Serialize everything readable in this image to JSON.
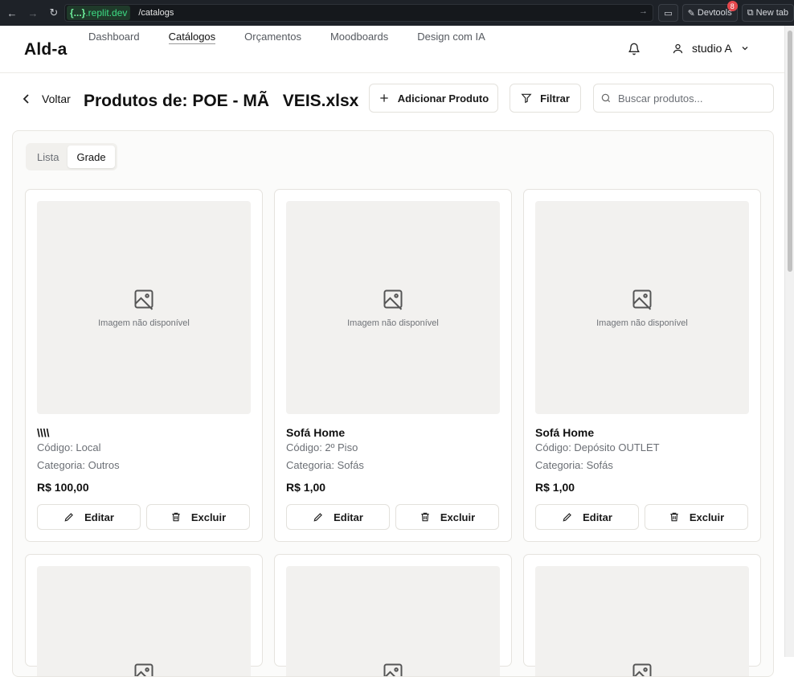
{
  "browser": {
    "url_host_prefix": "{...}",
    "url_host_suffix": ".replit.dev",
    "url_path": "/catalogs",
    "devtools_label": "Devtools",
    "devtools_badge": "8",
    "newtab_label": "New tab"
  },
  "header": {
    "logo": "Ald-a",
    "nav": [
      "Dashboard",
      "Catálogos",
      "Orçamentos",
      "Moodboards",
      "Design com IA"
    ],
    "active_nav": "Catálogos",
    "user_name": "studio A"
  },
  "toolbar": {
    "back_label": "Voltar",
    "title": "Produtos de: POE - MÃVEIS.xlsx",
    "add_label": "Adicionar Produto",
    "filter_label": "Filtrar",
    "search_placeholder": "Buscar produtos..."
  },
  "view_toggle": {
    "list_label": "Lista",
    "grid_label": "Grade",
    "selected": "Grade"
  },
  "image_placeholder": "Imagem não disponível",
  "buttons": {
    "edit": "Editar",
    "delete": "Excluir"
  },
  "products": [
    {
      "name": "\\\\\\\\",
      "code": "Código: Local",
      "category": "Categoria: Outros",
      "price": "R$ 100,00"
    },
    {
      "name": "Sofá Home",
      "code": "Código: 2º Piso",
      "category": "Categoria: Sofás",
      "price": "R$ 1,00"
    },
    {
      "name": "Sofá Home",
      "code": "Código: Depósito OUTLET",
      "category": "Categoria: Sofás",
      "price": "R$ 1,00"
    }
  ]
}
